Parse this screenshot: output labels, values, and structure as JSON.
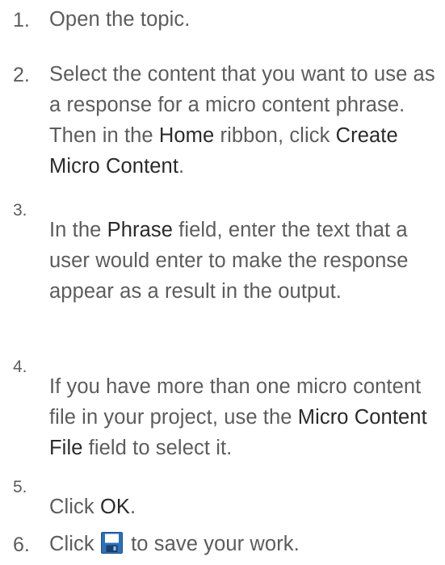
{
  "steps": [
    {
      "number": "1.",
      "parts": [
        "Open the topic."
      ]
    },
    {
      "number": "2.",
      "parts": [
        "Select the content that you want to use as a response for a micro content phrase. Then in the ",
        "Home",
        " ribbon, click ",
        "Create Micro Content",
        "."
      ]
    },
    {
      "number": "3.",
      "parts": [
        "In the ",
        "Phrase",
        " field, enter the text that a user would enter to make the response appear as a result in the output."
      ]
    },
    {
      "number": "4.",
      "parts": [
        "If you have more than one micro content file in your project, use the ",
        "Micro Content File",
        " field to select it."
      ]
    },
    {
      "number": "5.",
      "parts": [
        "Click ",
        "OK",
        "."
      ]
    },
    {
      "number": "6.",
      "parts": [
        "Click ",
        " to save your work."
      ],
      "icon": "save-icon"
    }
  ],
  "colors": {
    "text": "#5c5c5c",
    "ui_term": "#2a2a2a",
    "save_icon_blue": "#2f6fb5"
  }
}
